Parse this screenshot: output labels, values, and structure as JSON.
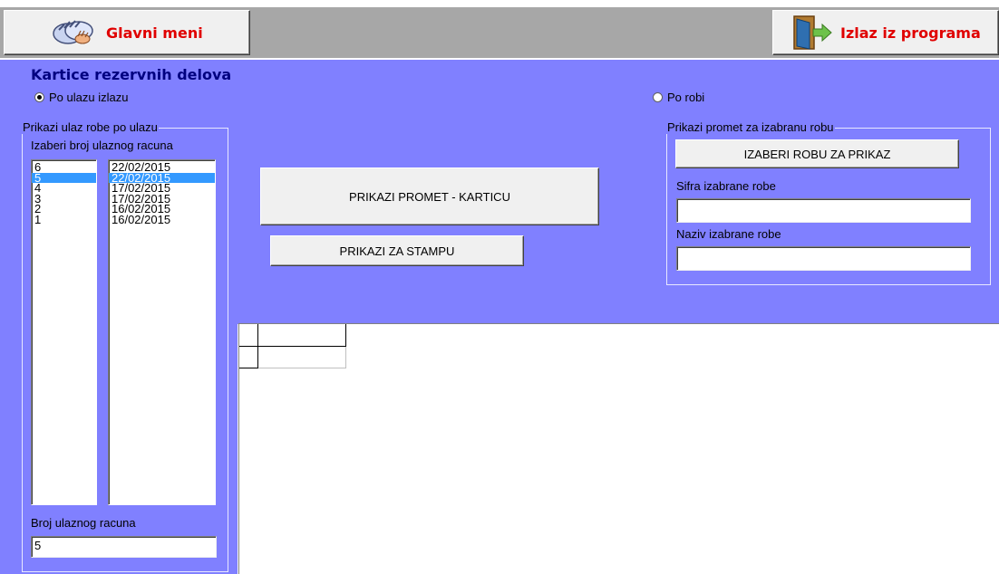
{
  "header": {
    "main_menu_label": "Glavni meni",
    "exit_label": "Izlaz iz programa"
  },
  "form": {
    "title": "Kartice rezervnih delova",
    "radio_by_entry": "Po ulazu izlazu",
    "radio_by_goods": "Po robi",
    "entry_group": {
      "legend": "Prikazi ulaz robe po ulazu",
      "select_label": "Izaberi broj ulaznog racuna",
      "numbers": [
        "6",
        "5",
        "4",
        "3",
        "2",
        "1"
      ],
      "dates": [
        "22/02/2015",
        "22/02/2015",
        "17/02/2015",
        "17/02/2015",
        "16/02/2015",
        "16/02/2015"
      ],
      "selected_index": 1,
      "entry_number_label": "Broj ulaznog racuna",
      "entry_number_value": "5"
    },
    "buttons": {
      "show_card": "PRIKAZI PROMET - KARTICU",
      "print": "PRIKAZI ZA STAMPU"
    },
    "goods_group": {
      "legend": "Prikazi promet za izabranu robu",
      "choose_button": "IZABERI ROBU ZA PRIKAZ",
      "code_label": "Sifra izabrane robe",
      "code_value": "",
      "name_label": "Naziv izabrane robe",
      "name_value": ""
    }
  },
  "colors": {
    "panel_bg": "#8080ff",
    "title": "#000080",
    "header_label": "#e00000",
    "selection": "#3399ff"
  }
}
